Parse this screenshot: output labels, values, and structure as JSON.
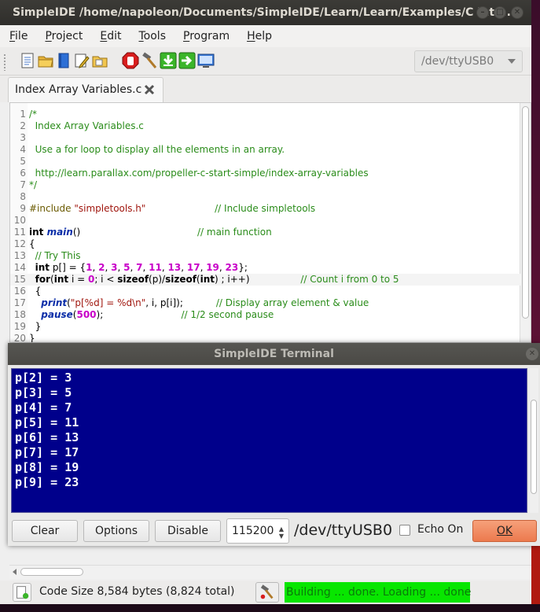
{
  "window": {
    "title": "SimpleIDE /home/napoleon/Documents/SimpleIDE/Learn/Learn/Examples/C Intr..."
  },
  "menu": [
    {
      "label": "File",
      "u": "F",
      "rest": "ile"
    },
    {
      "label": "Project",
      "u": "P",
      "rest": "roject"
    },
    {
      "label": "Edit",
      "u": "E",
      "rest": "dit"
    },
    {
      "label": "Tools",
      "u": "T",
      "rest": "ools"
    },
    {
      "label": "Program",
      "u": "P",
      "rest": "rogram"
    },
    {
      "label": "Help",
      "u": "H",
      "rest": "elp"
    }
  ],
  "toolbar": {
    "icons": [
      "new-file-icon",
      "open-folder-icon",
      "project-icon",
      "edit-project-icon",
      "project-folder-icon",
      "stop-icon",
      "build-hammer-icon",
      "load-ram-icon",
      "load-eeprom-icon",
      "run-terminal-icon"
    ],
    "port": "/dev/ttyUSB0"
  },
  "tab": {
    "label": "Index Array Variables.c"
  },
  "editor": {
    "current_line": 15,
    "lines": [
      {
        "n": "1",
        "parts": [
          [
            "com",
            "/*"
          ]
        ]
      },
      {
        "n": "2",
        "parts": [
          [
            "com",
            "  Index Array Variables.c"
          ]
        ]
      },
      {
        "n": "3",
        "parts": [
          [
            "com",
            ""
          ]
        ]
      },
      {
        "n": "4",
        "parts": [
          [
            "com",
            "  Use a for loop to display all the elements in an array."
          ]
        ]
      },
      {
        "n": "5",
        "parts": [
          [
            "com",
            ""
          ]
        ]
      },
      {
        "n": "6",
        "parts": [
          [
            "com",
            "  http://learn.parallax.com/propeller-c-start-simple/index-array-variables"
          ]
        ]
      },
      {
        "n": "7",
        "parts": [
          [
            "com",
            "*/"
          ]
        ]
      },
      {
        "n": "8",
        "parts": []
      },
      {
        "n": "9",
        "parts": [
          [
            "pre",
            "#include "
          ],
          [
            "str",
            "\"simpletools.h\""
          ],
          [
            "txt",
            "                       "
          ],
          [
            "com",
            "// Include simpletools"
          ]
        ]
      },
      {
        "n": "10",
        "parts": []
      },
      {
        "n": "11",
        "parts": [
          [
            "kw",
            "int "
          ],
          [
            "fn",
            "main"
          ],
          [
            "txt",
            "()                                       "
          ],
          [
            "com",
            "// main function"
          ]
        ]
      },
      {
        "n": "12",
        "parts": [
          [
            "txt",
            "{"
          ]
        ]
      },
      {
        "n": "13",
        "parts": [
          [
            "com",
            "  // Try This"
          ]
        ]
      },
      {
        "n": "14",
        "parts": [
          [
            "txt",
            "  "
          ],
          [
            "kw",
            "int"
          ],
          [
            "txt",
            " p[] = {"
          ],
          [
            "num",
            "1"
          ],
          [
            "txt",
            ", "
          ],
          [
            "num",
            "2"
          ],
          [
            "txt",
            ", "
          ],
          [
            "num",
            "3"
          ],
          [
            "txt",
            ", "
          ],
          [
            "num",
            "5"
          ],
          [
            "txt",
            ", "
          ],
          [
            "num",
            "7"
          ],
          [
            "txt",
            ", "
          ],
          [
            "num",
            "11"
          ],
          [
            "txt",
            ", "
          ],
          [
            "num",
            "13"
          ],
          [
            "txt",
            ", "
          ],
          [
            "num",
            "17"
          ],
          [
            "txt",
            ", "
          ],
          [
            "num",
            "19"
          ],
          [
            "txt",
            ", "
          ],
          [
            "num",
            "23"
          ],
          [
            "txt",
            "};"
          ]
        ]
      },
      {
        "n": "15",
        "parts": [
          [
            "txt",
            "  "
          ],
          [
            "kw",
            "for"
          ],
          [
            "txt",
            "("
          ],
          [
            "kw",
            "int"
          ],
          [
            "txt",
            " i = "
          ],
          [
            "num",
            "0"
          ],
          [
            "txt",
            "; i < "
          ],
          [
            "kw",
            "sizeof"
          ],
          [
            "txt",
            "(p)/"
          ],
          [
            "kw",
            "sizeof"
          ],
          [
            "txt",
            "("
          ],
          [
            "kw",
            "int"
          ],
          [
            "txt",
            ") ; i++)                 "
          ],
          [
            "com",
            "// Count i from 0 to 5"
          ]
        ]
      },
      {
        "n": "16",
        "parts": [
          [
            "txt",
            "  {"
          ]
        ]
      },
      {
        "n": "17",
        "parts": [
          [
            "txt",
            "    "
          ],
          [
            "fn",
            "print"
          ],
          [
            "txt",
            "("
          ],
          [
            "str",
            "\"p[%d] = %d\\n\""
          ],
          [
            "txt",
            ", i, p[i]);           "
          ],
          [
            "com",
            "// Display array element & value"
          ]
        ]
      },
      {
        "n": "18",
        "parts": [
          [
            "txt",
            "    "
          ],
          [
            "fn",
            "pause"
          ],
          [
            "txt",
            "("
          ],
          [
            "num",
            "500"
          ],
          [
            "txt",
            ");                          "
          ],
          [
            "com",
            "// 1/2 second pause"
          ]
        ]
      },
      {
        "n": "19",
        "parts": [
          [
            "txt",
            "  }"
          ]
        ]
      },
      {
        "n": "20",
        "parts": [
          [
            "txt",
            "}"
          ]
        ]
      }
    ]
  },
  "terminal": {
    "title": "SimpleIDE Terminal",
    "lines": [
      "p[2] = 3",
      "p[3] = 5",
      "p[4] = 7",
      "p[5] = 11",
      "p[6] = 13",
      "p[7] = 17",
      "p[8] = 19",
      "p[9] = 23"
    ],
    "buttons": {
      "clear": "Clear",
      "options": "Options",
      "disable": "Disable",
      "ok": "OK"
    },
    "baud": "115200",
    "port": "/dev/ttyUSB0",
    "echo_label": "Echo On",
    "echo_checked": false
  },
  "status": {
    "code_size": "Code Size 8,584 bytes (8,824 total)",
    "build_message": "Building ... done. Loading ...  done"
  }
}
